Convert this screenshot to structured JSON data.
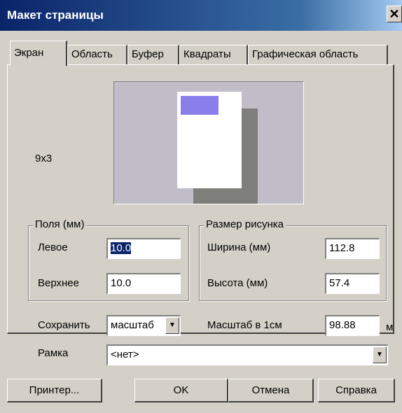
{
  "window": {
    "title": "Макет страницы",
    "close_glyph": "✕"
  },
  "tabs": [
    "Экран",
    "Область",
    "Буфер",
    "Квадраты",
    "Графическая область"
  ],
  "active_tab": "Экран",
  "preview": {
    "grid_label": "9x3",
    "image_color": "#8a7fea"
  },
  "margins": {
    "legend": "Поля (мм)",
    "left_label": "Левое",
    "left_value": "10.0",
    "top_label": "Верхнее",
    "top_value": "10.0"
  },
  "image_size": {
    "legend": "Размер рисунка",
    "width_label": "Ширина (мм)",
    "width_value": "112.8",
    "height_label": "Высота (мм)",
    "height_value": "57.4"
  },
  "save": {
    "label": "Сохранить",
    "value": "масштаб"
  },
  "scale": {
    "label": "Масштаб в 1см",
    "value": "98.88",
    "unit": "м"
  },
  "frame": {
    "label": "Рамка",
    "value": "<нет>"
  },
  "dropdown_glyph": "▼",
  "buttons": {
    "printer": "Принтер...",
    "ok": "OK",
    "cancel": "Отмена",
    "help": "Справка"
  }
}
